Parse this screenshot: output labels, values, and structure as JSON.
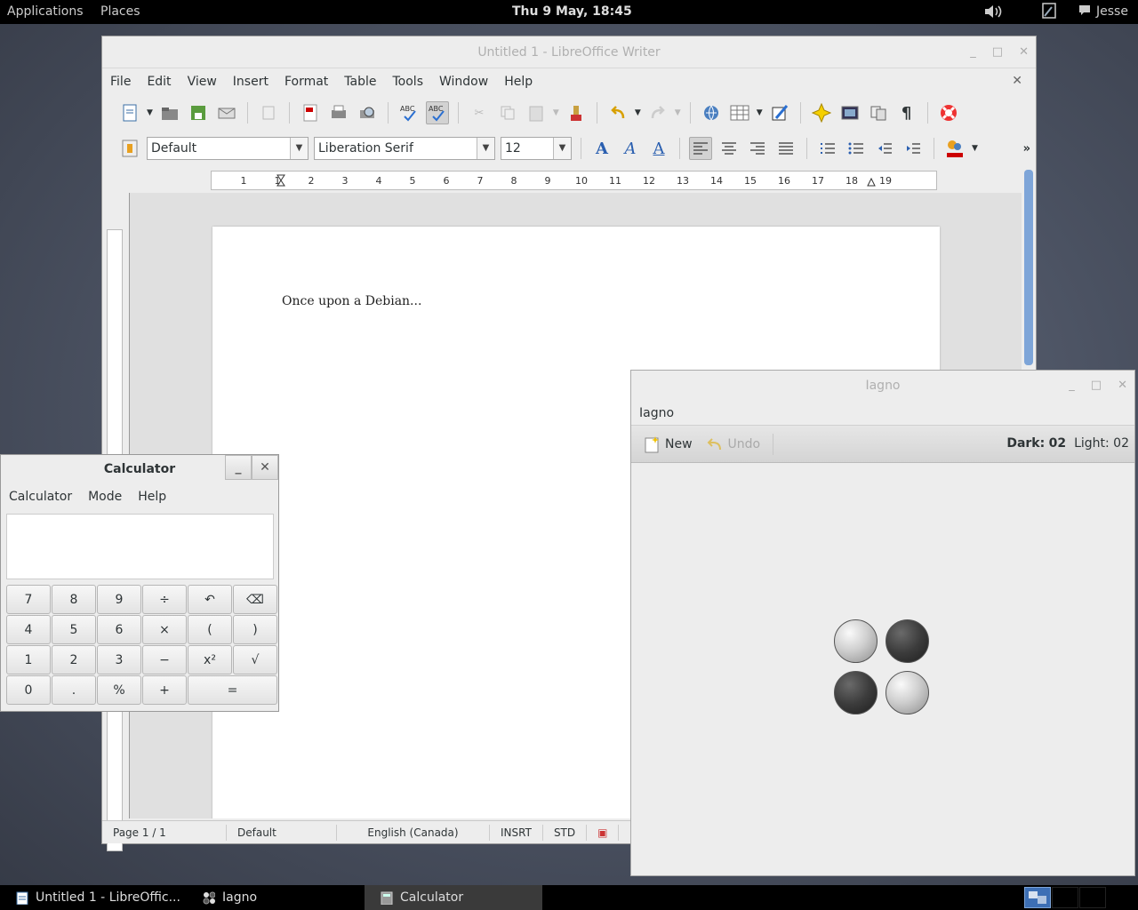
{
  "top_panel": {
    "applications": "Applications",
    "places": "Places",
    "clock": "Thu  9 May, 18:45",
    "user": "Jesse"
  },
  "writer": {
    "title": "Untitled 1 - LibreOffice Writer",
    "menu": [
      "File",
      "Edit",
      "View",
      "Insert",
      "Format",
      "Table",
      "Tools",
      "Window",
      "Help"
    ],
    "style": "Default",
    "font": "Liberation Serif",
    "size": "12",
    "ruler_labels": [
      "1",
      "1",
      "2",
      "3",
      "4",
      "5",
      "6",
      "7",
      "8",
      "9",
      "10",
      "11",
      "12",
      "13",
      "14",
      "15",
      "16",
      "17",
      "18",
      "19"
    ],
    "doc_text": "Once upon a Debian...",
    "status": {
      "page": "Page 1 / 1",
      "style": "Default",
      "lang": "English (Canada)",
      "insrt": "INSRT",
      "std": "STD"
    }
  },
  "iagno": {
    "title": "Iagno",
    "menu": "Iagno",
    "new": "New",
    "undo": "Undo",
    "dark_label": "Dark:",
    "dark": "02",
    "light_label": "Light:",
    "light": "02"
  },
  "calculator": {
    "title": "Calculator",
    "menu": [
      "Calculator",
      "Mode",
      "Help"
    ],
    "keys": [
      "7",
      "8",
      "9",
      "÷",
      "↶",
      "⌫",
      "4",
      "5",
      "6",
      "×",
      "(",
      ")",
      "1",
      "2",
      "3",
      "−",
      "x²",
      "√",
      "0",
      ".",
      "%",
      "+",
      "="
    ]
  },
  "taskbar": {
    "items": [
      "Untitled 1 - LibreOffic...",
      "Iagno",
      "Calculator"
    ]
  },
  "colors": {
    "accent": "#7ea5d8",
    "panel": "#000000"
  }
}
